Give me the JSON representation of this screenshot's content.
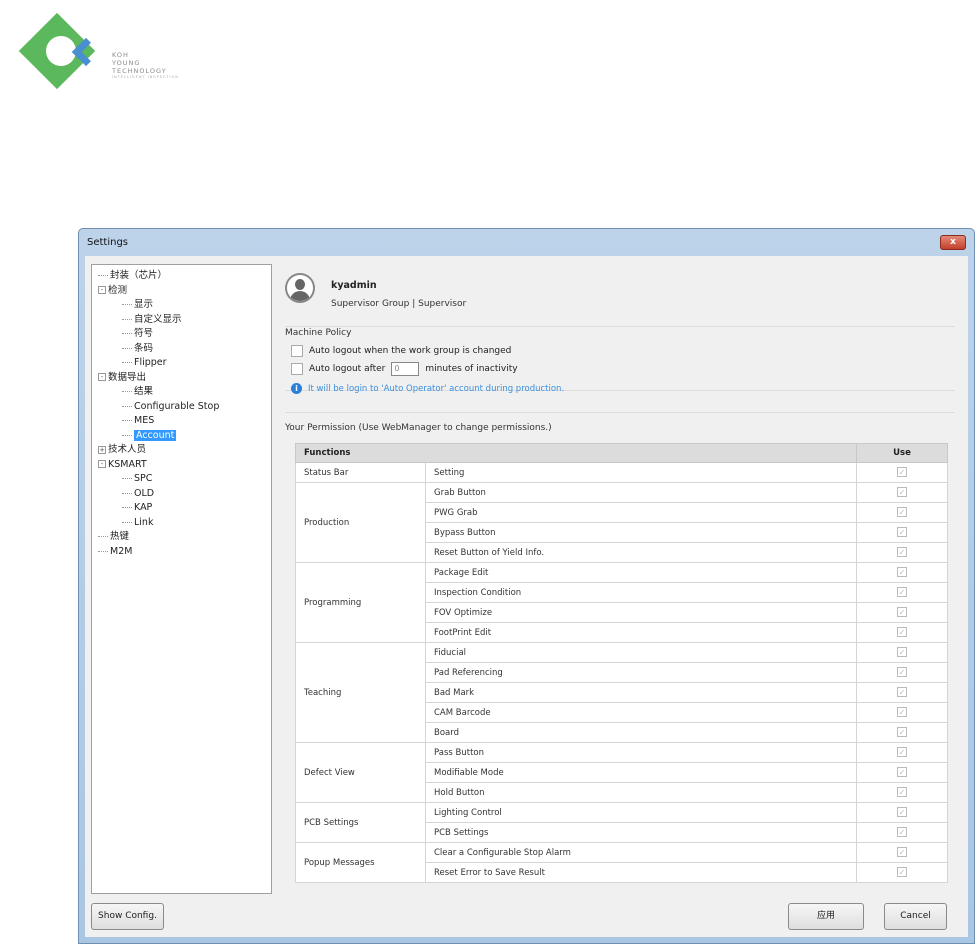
{
  "logo": {
    "lines": [
      "KOH",
      "YOUNG",
      "TECHNOLOGY"
    ],
    "tagline": "INTELLIGENT INSPECTION"
  },
  "dialog": {
    "title": "Settings",
    "close": "x"
  },
  "tree": [
    {
      "label": "封装（芯片）",
      "level": 0,
      "exp": ""
    },
    {
      "label": "检测",
      "level": 0,
      "exp": "-"
    },
    {
      "label": "显示",
      "level": 1
    },
    {
      "label": "自定义显示",
      "level": 1
    },
    {
      "label": "符号",
      "level": 1
    },
    {
      "label": "条码",
      "level": 1
    },
    {
      "label": "Flipper",
      "level": 1
    },
    {
      "label": "数据导出",
      "level": 0,
      "exp": "-"
    },
    {
      "label": "结果",
      "level": 1
    },
    {
      "label": "Configurable Stop",
      "level": 1
    },
    {
      "label": "MES",
      "level": 1
    },
    {
      "label": "Account",
      "level": 1,
      "selected": true
    },
    {
      "label": "技术人员",
      "level": 0,
      "exp": "+"
    },
    {
      "label": "KSMART",
      "level": 0,
      "exp": "-"
    },
    {
      "label": "SPC",
      "level": 1
    },
    {
      "label": "OLD",
      "level": 1
    },
    {
      "label": "KAP",
      "level": 1
    },
    {
      "label": "Link",
      "level": 1
    },
    {
      "label": "热键",
      "level": 0,
      "exp": ""
    },
    {
      "label": "M2M",
      "level": 0,
      "exp": ""
    }
  ],
  "user": {
    "name": "kyadmin",
    "group": "Supervisor Group | Supervisor"
  },
  "policy": {
    "title": "Machine Policy",
    "opt1": "Auto logout when the work group is changed",
    "opt2_pre": "Auto logout after",
    "opt2_value": "0",
    "opt2_post": "minutes of inactivity",
    "info": "It will be login to 'Auto Operator' account during production."
  },
  "permission": {
    "title": "Your Permission (Use WebManager to change permissions.)",
    "col_functions": "Functions",
    "col_use": "Use",
    "groups": [
      {
        "name": "Status Bar",
        "items": [
          "Setting"
        ]
      },
      {
        "name": "Production",
        "items": [
          "Grab Button",
          "PWG Grab",
          "Bypass Button",
          "Reset Button of Yield Info."
        ]
      },
      {
        "name": "Programming",
        "items": [
          "Package Edit",
          "Inspection Condition",
          "FOV Optimize",
          "FootPrint Edit"
        ]
      },
      {
        "name": "Teaching",
        "items": [
          "Fiducial",
          "Pad Referencing",
          "Bad Mark",
          "CAM Barcode",
          "Board"
        ]
      },
      {
        "name": "Defect View",
        "items": [
          "Pass Button",
          "Modifiable Mode",
          "Hold Button"
        ]
      },
      {
        "name": "PCB Settings",
        "items": [
          "Lighting Control",
          "PCB Settings"
        ]
      },
      {
        "name": "Popup Messages",
        "items": [
          "Clear a Configurable Stop Alarm",
          "Reset Error to Save Result"
        ]
      }
    ]
  },
  "buttons": {
    "show_config": "Show Config.",
    "apply": "应用",
    "cancel": "Cancel"
  }
}
